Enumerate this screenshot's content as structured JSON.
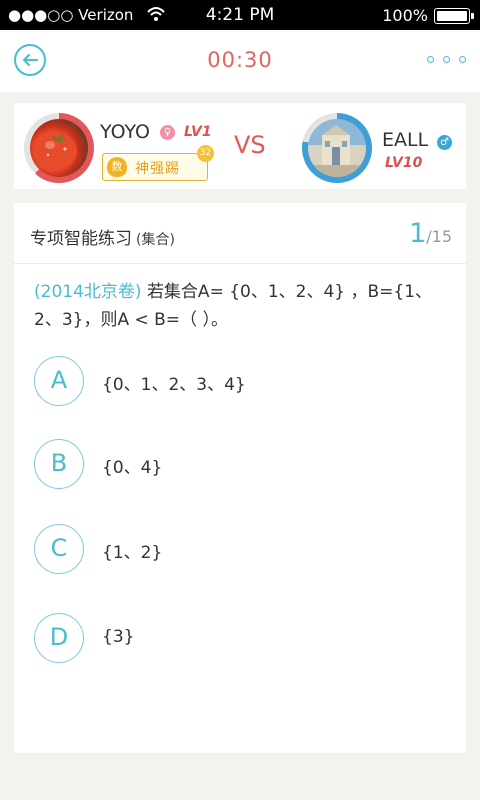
{
  "status_bar": {
    "carrier": "●●●○○ Verizon",
    "time": "4:21 PM",
    "battery": "100%"
  },
  "header": {
    "timer": "00:30"
  },
  "vs_panel": {
    "left_player": {
      "name": "YOYO",
      "gender": "female",
      "level": "LV1",
      "title_badge": {
        "icon_char": "数",
        "text": "神强踢",
        "count": "32"
      }
    },
    "vs_label": "VS",
    "right_player": {
      "name": "EALL",
      "gender": "male",
      "level": "LV10"
    }
  },
  "question": {
    "category": "专项智能练习",
    "subcategory": "(集合)",
    "current": "1",
    "total": "/15",
    "source": "(2014北京卷)",
    "text": "若集合A= {0、1、2、4} ，B={1、2、3}，则A < B=（ ）。",
    "options": [
      {
        "letter": "A",
        "text": "{0、1、2、3、4}"
      },
      {
        "letter": "B",
        "text": "{0、4}"
      },
      {
        "letter": "C",
        "text": "{1、2}"
      },
      {
        "letter": "D",
        "text": "{3}"
      }
    ]
  },
  "colors": {
    "accent": "#49bccd",
    "red": "#e25858",
    "timer": "#e06464"
  }
}
